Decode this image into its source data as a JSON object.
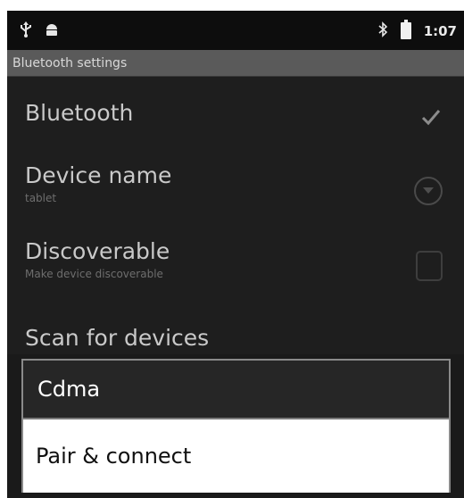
{
  "statusbar": {
    "left_icons": [
      "usb-icon",
      "android-debug-icon"
    ],
    "right_icons": [
      "bluetooth-icon",
      "battery-icon"
    ],
    "time": "1:07"
  },
  "titlebar": {
    "title": "Bluetooth settings"
  },
  "preferences": {
    "bluetooth": {
      "title": "Bluetooth",
      "checked": true
    },
    "device_name": {
      "title": "Device name",
      "summary": "tablet"
    },
    "discoverable": {
      "title": "Discoverable",
      "summary": "Make device discoverable",
      "checked": false
    },
    "scan": {
      "title": "Scan for devices"
    }
  },
  "dialog": {
    "title": "Cdma",
    "items": [
      "Pair & connect"
    ]
  }
}
